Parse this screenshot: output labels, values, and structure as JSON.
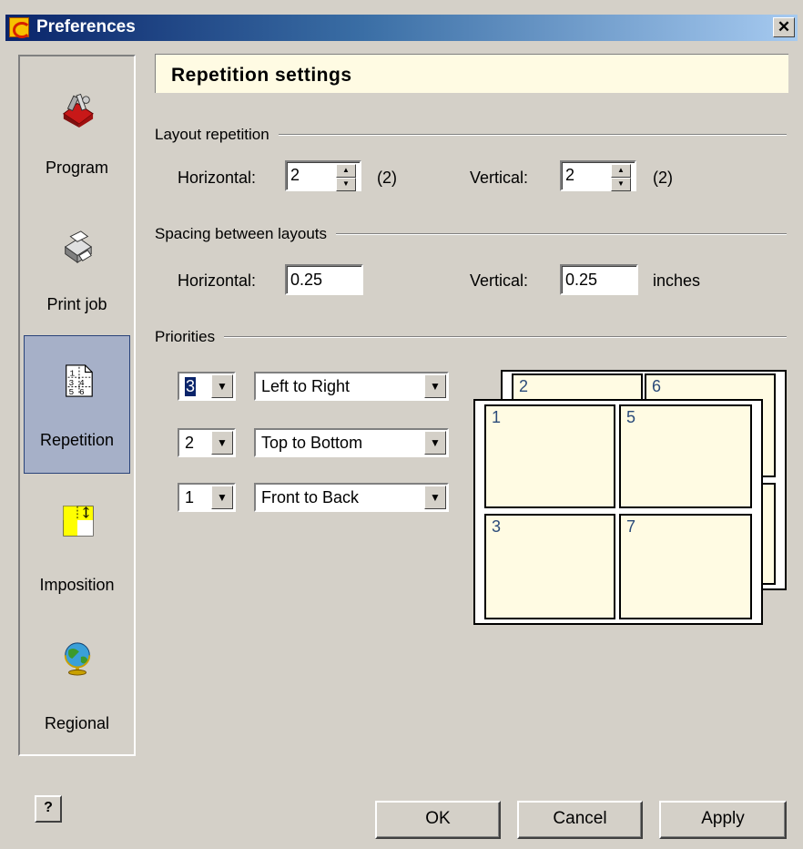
{
  "window": {
    "title": "Preferences"
  },
  "sidebar": {
    "items": [
      {
        "label": "Program",
        "icon": "toolbox-icon"
      },
      {
        "label": "Print job",
        "icon": "printer-icon"
      },
      {
        "label": "Repetition",
        "icon": "repetition-grid-icon",
        "active": true,
        "icon_text": [
          "1",
          "3 4",
          "5 6"
        ]
      },
      {
        "label": "Imposition",
        "icon": "imposition-icon"
      },
      {
        "label": "Regional",
        "icon": "globe-icon"
      }
    ]
  },
  "header": {
    "title": "Repetition settings"
  },
  "layout_repetition": {
    "title": "Layout repetition",
    "horizontal_label": "Horizontal:",
    "horizontal_value": "2",
    "horizontal_effective": "(2)",
    "vertical_label": "Vertical:",
    "vertical_value": "2",
    "vertical_effective": "(2)"
  },
  "spacing": {
    "title": "Spacing between layouts",
    "horizontal_label": "Horizontal:",
    "horizontal_value": "0.25",
    "vertical_label": "Vertical:",
    "vertical_value": "0.25",
    "unit": "inches"
  },
  "priorities": {
    "title": "Priorities",
    "rows": [
      {
        "rank": "3",
        "direction": "Left to Right"
      },
      {
        "rank": "2",
        "direction": "Top to Bottom"
      },
      {
        "rank": "1",
        "direction": "Front to Back"
      }
    ]
  },
  "preview": {
    "back_cells": [
      "2",
      "6"
    ],
    "front_cells": [
      "1",
      "5",
      "3",
      "7"
    ],
    "cell_color": "#fffbe3"
  },
  "buttons": {
    "ok": "OK",
    "cancel": "Cancel",
    "apply": "Apply",
    "help": "?"
  },
  "colors": {
    "titlebar_start": "#0a246a",
    "titlebar_end": "#a6caf0",
    "header_bg": "#fffbe3",
    "active_item": "#a6b0c8"
  }
}
